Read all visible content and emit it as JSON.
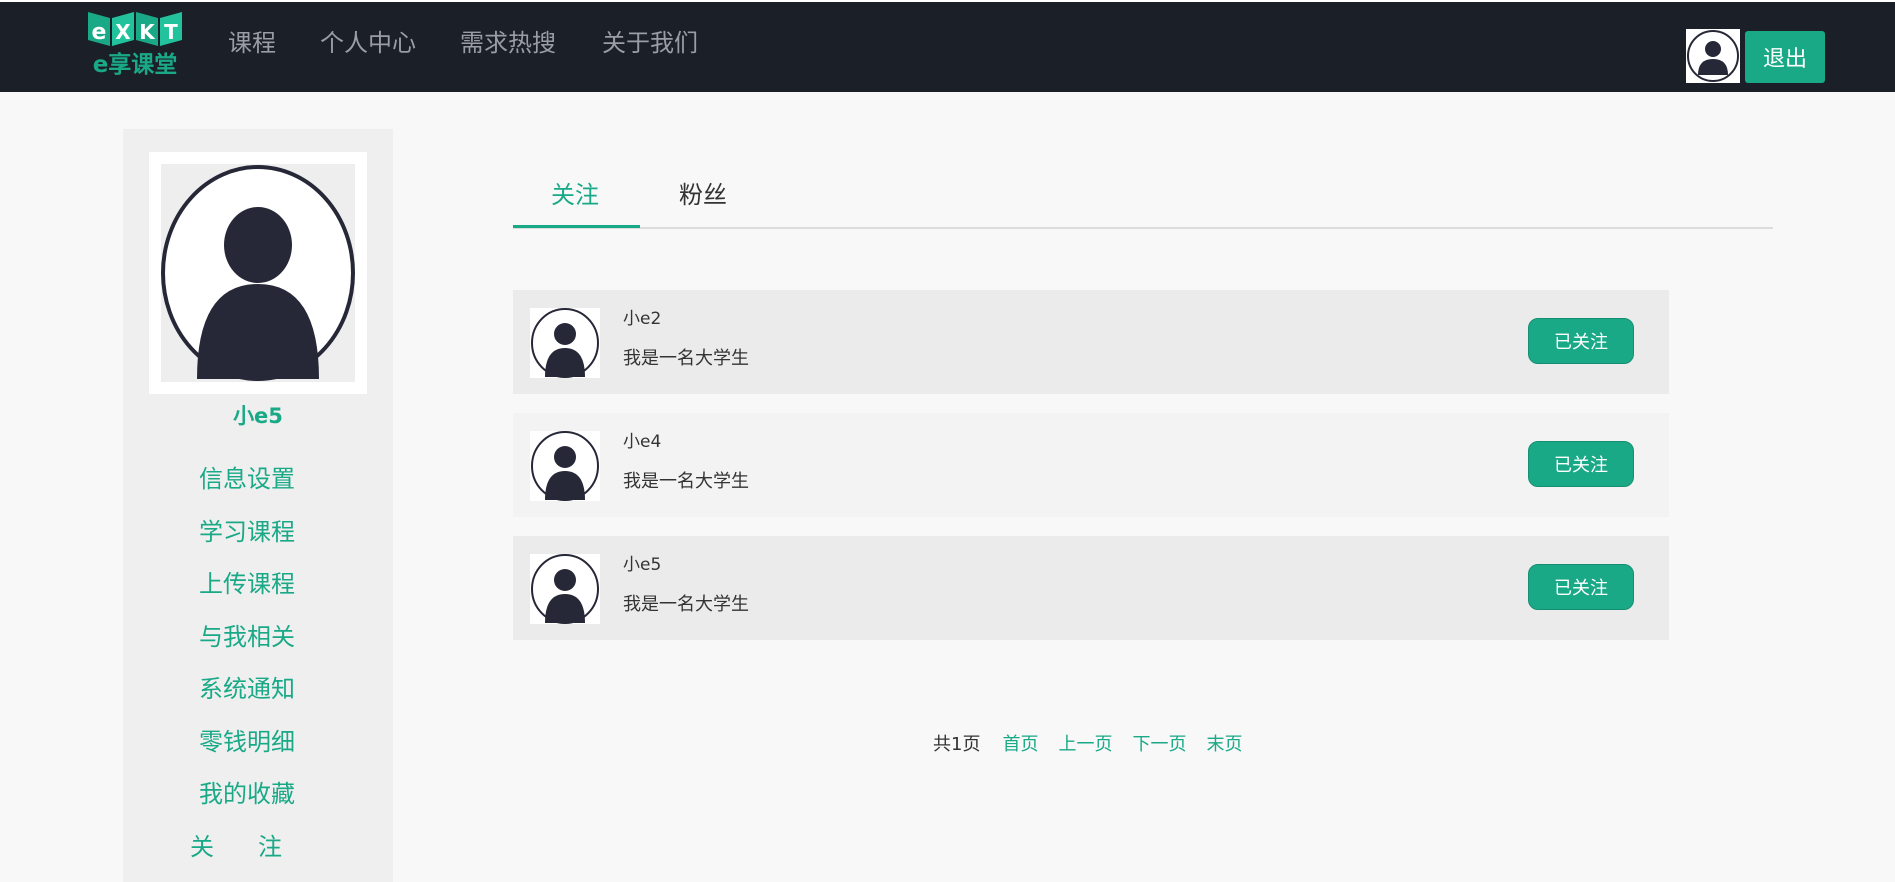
{
  "header": {
    "logo_text": "eXKT e享课堂",
    "nav": [
      "课程",
      "个人中心",
      "需求热搜",
      "关于我们"
    ],
    "logout_label": "退出"
  },
  "sidebar": {
    "username": "小e5",
    "menu": [
      "信息设置",
      "学习课程",
      "上传课程",
      "与我相关",
      "系统通知",
      "零钱明细",
      "我的收藏",
      "关注"
    ]
  },
  "tabs": [
    "关注",
    "粉丝"
  ],
  "active_tab": "关注",
  "follows": [
    {
      "name": "小e2",
      "desc": "我是一名大学生",
      "button": "已关注"
    },
    {
      "name": "小e4",
      "desc": "我是一名大学生",
      "button": "已关注"
    },
    {
      "name": "小e5",
      "desc": "我是一名大学生",
      "button": "已关注"
    }
  ],
  "pagination": {
    "total": "共1页",
    "first": "首页",
    "prev": "上一页",
    "next": "下一页",
    "last": "末页"
  },
  "colors": {
    "accent": "#1aa987",
    "header_bg": "#1b1f27",
    "page_bg": "#f8f8f8"
  }
}
